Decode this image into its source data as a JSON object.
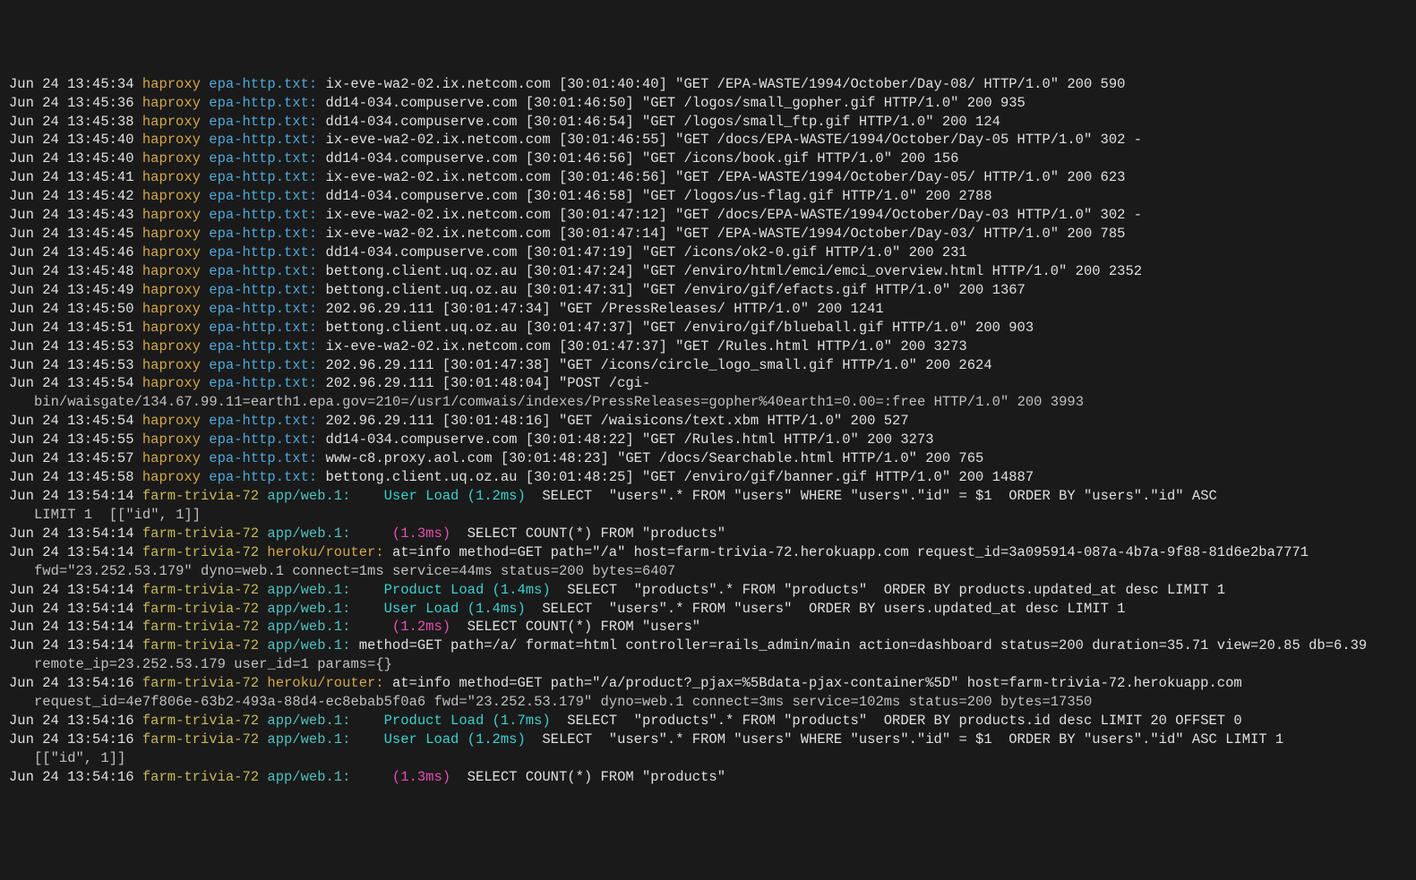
{
  "lines": [
    {
      "type": "hap",
      "ts": "Jun 24 13:45:34",
      "app": "haproxy",
      "src": "epa-http.txt:",
      "msg": "ix-eve-wa2-02.ix.netcom.com [30:01:40:40] \"GET /EPA-WASTE/1994/October/Day-08/ HTTP/1.0\" 200 590"
    },
    {
      "type": "hap",
      "ts": "Jun 24 13:45:36",
      "app": "haproxy",
      "src": "epa-http.txt:",
      "msg": "dd14-034.compuserve.com [30:01:46:50] \"GET /logos/small_gopher.gif HTTP/1.0\" 200 935"
    },
    {
      "type": "hap",
      "ts": "Jun 24 13:45:38",
      "app": "haproxy",
      "src": "epa-http.txt:",
      "msg": "dd14-034.compuserve.com [30:01:46:54] \"GET /logos/small_ftp.gif HTTP/1.0\" 200 124"
    },
    {
      "type": "hap",
      "ts": "Jun 24 13:45:40",
      "app": "haproxy",
      "src": "epa-http.txt:",
      "msg": "ix-eve-wa2-02.ix.netcom.com [30:01:46:55] \"GET /docs/EPA-WASTE/1994/October/Day-05 HTTP/1.0\" 302 -"
    },
    {
      "type": "hap",
      "ts": "Jun 24 13:45:40",
      "app": "haproxy",
      "src": "epa-http.txt:",
      "msg": "dd14-034.compuserve.com [30:01:46:56] \"GET /icons/book.gif HTTP/1.0\" 200 156"
    },
    {
      "type": "hap",
      "ts": "Jun 24 13:45:41",
      "app": "haproxy",
      "src": "epa-http.txt:",
      "msg": "ix-eve-wa2-02.ix.netcom.com [30:01:46:56] \"GET /EPA-WASTE/1994/October/Day-05/ HTTP/1.0\" 200 623"
    },
    {
      "type": "hap",
      "ts": "Jun 24 13:45:42",
      "app": "haproxy",
      "src": "epa-http.txt:",
      "msg": "dd14-034.compuserve.com [30:01:46:58] \"GET /logos/us-flag.gif HTTP/1.0\" 200 2788"
    },
    {
      "type": "hap",
      "ts": "Jun 24 13:45:43",
      "app": "haproxy",
      "src": "epa-http.txt:",
      "msg": "ix-eve-wa2-02.ix.netcom.com [30:01:47:12] \"GET /docs/EPA-WASTE/1994/October/Day-03 HTTP/1.0\" 302 -"
    },
    {
      "type": "hap",
      "ts": "Jun 24 13:45:45",
      "app": "haproxy",
      "src": "epa-http.txt:",
      "msg": "ix-eve-wa2-02.ix.netcom.com [30:01:47:14] \"GET /EPA-WASTE/1994/October/Day-03/ HTTP/1.0\" 200 785"
    },
    {
      "type": "hap",
      "ts": "Jun 24 13:45:46",
      "app": "haproxy",
      "src": "epa-http.txt:",
      "msg": "dd14-034.compuserve.com [30:01:47:19] \"GET /icons/ok2-0.gif HTTP/1.0\" 200 231"
    },
    {
      "type": "hap",
      "ts": "Jun 24 13:45:48",
      "app": "haproxy",
      "src": "epa-http.txt:",
      "msg": "bettong.client.uq.oz.au [30:01:47:24] \"GET /enviro/html/emci/emci_overview.html HTTP/1.0\" 200 2352"
    },
    {
      "type": "hap",
      "ts": "Jun 24 13:45:49",
      "app": "haproxy",
      "src": "epa-http.txt:",
      "msg": "bettong.client.uq.oz.au [30:01:47:31] \"GET /enviro/gif/efacts.gif HTTP/1.0\" 200 1367"
    },
    {
      "type": "hap",
      "ts": "Jun 24 13:45:50",
      "app": "haproxy",
      "src": "epa-http.txt:",
      "msg": "202.96.29.111 [30:01:47:34] \"GET /PressReleases/ HTTP/1.0\" 200 1241"
    },
    {
      "type": "hap",
      "ts": "Jun 24 13:45:51",
      "app": "haproxy",
      "src": "epa-http.txt:",
      "msg": "bettong.client.uq.oz.au [30:01:47:37] \"GET /enviro/gif/blueball.gif HTTP/1.0\" 200 903"
    },
    {
      "type": "hap",
      "ts": "Jun 24 13:45:53",
      "app": "haproxy",
      "src": "epa-http.txt:",
      "msg": "ix-eve-wa2-02.ix.netcom.com [30:01:47:37] \"GET /Rules.html HTTP/1.0\" 200 3273"
    },
    {
      "type": "hap",
      "ts": "Jun 24 13:45:53",
      "app": "haproxy",
      "src": "epa-http.txt:",
      "msg": "202.96.29.111 [30:01:47:38] \"GET /icons/circle_logo_small.gif HTTP/1.0\" 200 2624"
    },
    {
      "type": "hap",
      "ts": "Jun 24 13:45:54",
      "app": "haproxy",
      "src": "epa-http.txt:",
      "msg": "202.96.29.111 [30:01:48:04] \"POST /cgi-",
      "cont": "bin/waisgate/134.67.99.11=earth1.epa.gov=210=/usr1/comwais/indexes/PressReleases=gopher%40earth1=0.00=:free HTTP/1.0\" 200 3993"
    },
    {
      "type": "hap",
      "ts": "Jun 24 13:45:54",
      "app": "haproxy",
      "src": "epa-http.txt:",
      "msg": "202.96.29.111 [30:01:48:16] \"GET /waisicons/text.xbm HTTP/1.0\" 200 527"
    },
    {
      "type": "hap",
      "ts": "Jun 24 13:45:55",
      "app": "haproxy",
      "src": "epa-http.txt:",
      "msg": "dd14-034.compuserve.com [30:01:48:22] \"GET /Rules.html HTTP/1.0\" 200 3273"
    },
    {
      "type": "hap",
      "ts": "Jun 24 13:45:57",
      "app": "haproxy",
      "src": "epa-http.txt:",
      "msg": "www-c8.proxy.aol.com [30:01:48:23] \"GET /docs/Searchable.html HTTP/1.0\" 200 765"
    },
    {
      "type": "hap",
      "ts": "Jun 24 13:45:58",
      "app": "haproxy",
      "src": "epa-http.txt:",
      "msg": "bettong.client.uq.oz.au [30:01:48:25] \"GET /enviro/gif/banner.gif HTTP/1.0\" 200 14887"
    },
    {
      "type": "farm",
      "ts": "Jun 24 13:54:14",
      "app": "farm-trivia-72",
      "src": "app/web.1:",
      "load": "  User Load (1.2ms)",
      "loadClass": "load-cyan",
      "sql": "  SELECT  \"users\".* FROM \"users\" WHERE \"users\".\"id\" = $1  ORDER BY \"users\".\"id\" ASC",
      "cont": "LIMIT 1  [[\"id\", 1]]"
    },
    {
      "type": "farm",
      "ts": "Jun 24 13:54:14",
      "app": "farm-trivia-72",
      "src": "app/web.1:",
      "load": "   (1.3ms)",
      "loadClass": "load-mag",
      "sql": "  SELECT COUNT(*) FROM \"products\""
    },
    {
      "type": "farm",
      "ts": "Jun 24 13:54:14",
      "app": "farm-trivia-72",
      "src": "heroku/router:",
      "srcClass": "src-router",
      "msg": "at=info method=GET path=\"/a\" host=farm-trivia-72.herokuapp.com request_id=3a095914-087a-4b7a-9f88-81d6e2ba7771",
      "cont": "fwd=\"23.252.53.179\" dyno=web.1 connect=1ms service=44ms status=200 bytes=6407"
    },
    {
      "type": "farm",
      "ts": "Jun 24 13:54:14",
      "app": "farm-trivia-72",
      "src": "app/web.1:",
      "load": "  Product Load (1.4ms)",
      "loadClass": "load-cyan",
      "sql": "  SELECT  \"products\".* FROM \"products\"  ORDER BY products.updated_at desc LIMIT 1"
    },
    {
      "type": "farm",
      "ts": "Jun 24 13:54:14",
      "app": "farm-trivia-72",
      "src": "app/web.1:",
      "load": "  User Load (1.4ms)",
      "loadClass": "load-cyan",
      "sql": "  SELECT  \"users\".* FROM \"users\"  ORDER BY users.updated_at desc LIMIT 1"
    },
    {
      "type": "farm",
      "ts": "Jun 24 13:54:14",
      "app": "farm-trivia-72",
      "src": "app/web.1:",
      "load": "   (1.2ms)",
      "loadClass": "load-mag",
      "sql": "  SELECT COUNT(*) FROM \"users\""
    },
    {
      "type": "farm",
      "ts": "Jun 24 13:54:14",
      "app": "farm-trivia-72",
      "src": "app/web.1:",
      "msg": "method=GET path=/a/ format=html controller=rails_admin/main action=dashboard status=200 duration=35.71 view=20.85 db=6.39",
      "cont": "remote_ip=23.252.53.179 user_id=1 params={}"
    },
    {
      "type": "farm",
      "ts": "Jun 24 13:54:16",
      "app": "farm-trivia-72",
      "src": "heroku/router:",
      "srcClass": "src-router",
      "msg": "at=info method=GET path=\"/a/product?_pjax=%5Bdata-pjax-container%5D\" host=farm-trivia-72.herokuapp.com",
      "cont": "request_id=4e7f806e-63b2-493a-88d4-ec8ebab5f0a6 fwd=\"23.252.53.179\" dyno=web.1 connect=3ms service=102ms status=200 bytes=17350"
    },
    {
      "type": "farm",
      "ts": "Jun 24 13:54:16",
      "app": "farm-trivia-72",
      "src": "app/web.1:",
      "load": "  Product Load (1.7ms)",
      "loadClass": "load-cyan",
      "sql": "  SELECT  \"products\".* FROM \"products\"  ORDER BY products.id desc LIMIT 20 OFFSET 0"
    },
    {
      "type": "farm",
      "ts": "Jun 24 13:54:16",
      "app": "farm-trivia-72",
      "src": "app/web.1:",
      "load": "  User Load (1.2ms)",
      "loadClass": "load-cyan",
      "sql": "  SELECT  \"users\".* FROM \"users\" WHERE \"users\".\"id\" = $1  ORDER BY \"users\".\"id\" ASC LIMIT 1",
      "cont": "[[\"id\", 1]]"
    },
    {
      "type": "farm",
      "ts": "Jun 24 13:54:16",
      "app": "farm-trivia-72",
      "src": "app/web.1:",
      "load": "   (1.3ms)",
      "loadClass": "load-mag",
      "sql": "  SELECT COUNT(*) FROM \"products\""
    }
  ]
}
